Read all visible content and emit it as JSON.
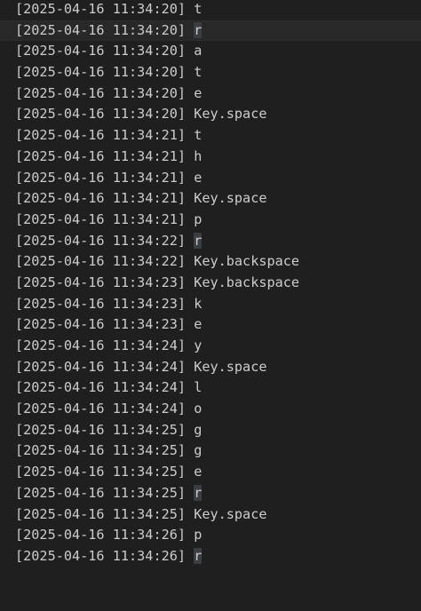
{
  "log": {
    "lines": [
      {
        "ts": "[2025-04-16 11:34:20]",
        "key": "t"
      },
      {
        "ts": "[2025-04-16 11:34:20]",
        "key": "r",
        "hl": true,
        "current": true
      },
      {
        "ts": "[2025-04-16 11:34:20]",
        "key": "a"
      },
      {
        "ts": "[2025-04-16 11:34:20]",
        "key": "t"
      },
      {
        "ts": "[2025-04-16 11:34:20]",
        "key": "e"
      },
      {
        "ts": "[2025-04-16 11:34:20]",
        "key": "Key.space"
      },
      {
        "ts": "[2025-04-16 11:34:21]",
        "key": "t"
      },
      {
        "ts": "[2025-04-16 11:34:21]",
        "key": "h"
      },
      {
        "ts": "[2025-04-16 11:34:21]",
        "key": "e"
      },
      {
        "ts": "[2025-04-16 11:34:21]",
        "key": "Key.space"
      },
      {
        "ts": "[2025-04-16 11:34:21]",
        "key": "p"
      },
      {
        "ts": "[2025-04-16 11:34:22]",
        "key": "r",
        "hl": true
      },
      {
        "ts": "[2025-04-16 11:34:22]",
        "key": "Key.backspace"
      },
      {
        "ts": "[2025-04-16 11:34:23]",
        "key": "Key.backspace"
      },
      {
        "ts": "[2025-04-16 11:34:23]",
        "key": "k"
      },
      {
        "ts": "[2025-04-16 11:34:23]",
        "key": "e"
      },
      {
        "ts": "[2025-04-16 11:34:24]",
        "key": "y"
      },
      {
        "ts": "[2025-04-16 11:34:24]",
        "key": "Key.space"
      },
      {
        "ts": "[2025-04-16 11:34:24]",
        "key": "l"
      },
      {
        "ts": "[2025-04-16 11:34:24]",
        "key": "o"
      },
      {
        "ts": "[2025-04-16 11:34:25]",
        "key": "g"
      },
      {
        "ts": "[2025-04-16 11:34:25]",
        "key": "g"
      },
      {
        "ts": "[2025-04-16 11:34:25]",
        "key": "e"
      },
      {
        "ts": "[2025-04-16 11:34:25]",
        "key": "r",
        "hl": true
      },
      {
        "ts": "[2025-04-16 11:34:25]",
        "key": "Key.space"
      },
      {
        "ts": "[2025-04-16 11:34:26]",
        "key": "p"
      },
      {
        "ts": "[2025-04-16 11:34:26]",
        "key": "r",
        "hl": true
      }
    ]
  }
}
